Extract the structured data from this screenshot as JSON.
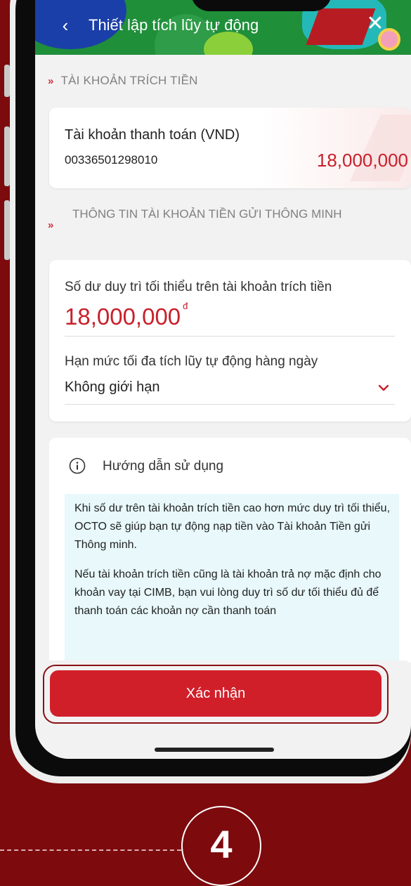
{
  "header": {
    "title": "Thiết lập tích lũy tự động",
    "back_icon": "‹",
    "close_icon": "✕"
  },
  "section_source": {
    "label": "TÀI KHOẢN TRÍCH TIỀN",
    "account_name": "Tài khoản thanh toán (VND)",
    "account_number": "00336501298010",
    "balance": "18,000,000"
  },
  "section_smart": {
    "label": "THÔNG TIN TÀI KHOẢN TIỀN GỬI THÔNG MINH"
  },
  "form": {
    "min_balance_label": "Số dư duy trì tối thiểu trên tài khoản trích tiền",
    "min_balance_value": "18,000,000",
    "currency_symbol": "đ",
    "daily_limit_label": "Hạn mức tối đa tích lũy tự động hàng ngày",
    "daily_limit_value": "Không giới hạn"
  },
  "guide": {
    "title": "Hướng dẫn sử dụng",
    "paragraph1": "Khi số dư trên tài khoản trích tiền cao hơn mức duy trì tối thiểu, OCTO sẽ giúp bạn tự động nạp tiền vào Tài khoản Tiền gửi Thông minh.",
    "paragraph2": "Nếu tài khoản trích tiền cũng là tài khoản trả nợ mặc định cho khoản vay tại CIMB, bạn vui lòng duy trì số dư tối thiểu đủ để thanh toán các khoản nợ cần thanh toán"
  },
  "confirm_label": "Xác nhận",
  "step_number": "4",
  "colors": {
    "accent_red": "#c8202b",
    "button_red": "#d11f2a",
    "background_maroon": "#7d0a0d",
    "guide_bg": "#e8f8fb"
  }
}
